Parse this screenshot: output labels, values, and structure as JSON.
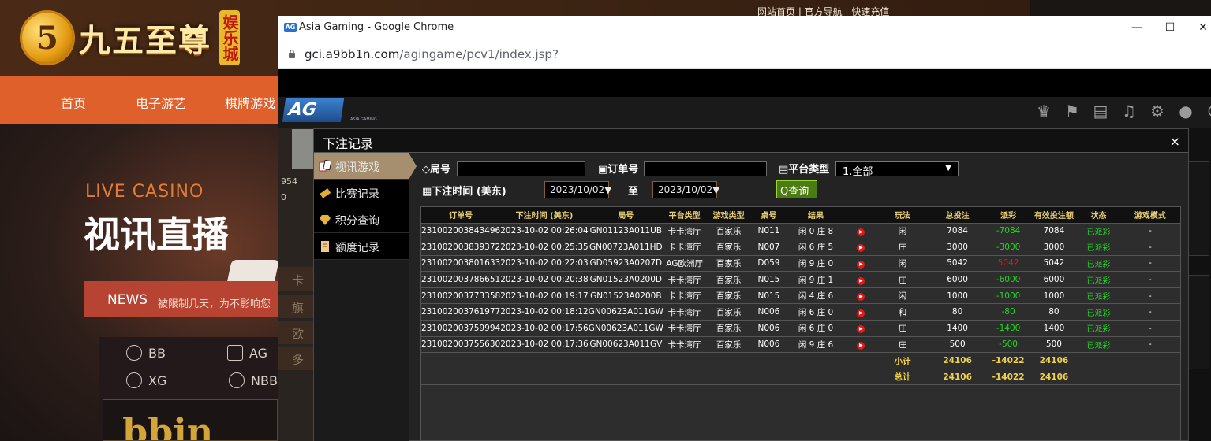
{
  "background_site": {
    "logo_text": "九五至尊",
    "logo_badge": "娱乐城",
    "top_links": "网站首页 | 官方导航 | 快速充值",
    "nav": [
      "首页",
      "电子游艺",
      "棋牌游戏"
    ],
    "live_casino": "LIVE CASINO",
    "live_title": "视讯直播",
    "news_label": "NEWS",
    "news_text": "被限制几天，为不影响您",
    "games": [
      {
        "label": "BB",
        "icon": "bb-icon"
      },
      {
        "label": "AG",
        "icon": "ag-icon"
      },
      {
        "label": "XG",
        "icon": "xg-icon"
      },
      {
        "label": "NBB",
        "icon": "nbb-icon"
      }
    ],
    "bbin": "bbin"
  },
  "browser": {
    "title": "Asia Gaming - Google Chrome",
    "favicon": "AG",
    "url_domain": "gci.a9bb1n.com",
    "url_path": "/agingame/pcv1/index.jsp?"
  },
  "game_page": {
    "ag_logo": "AG",
    "ag_sub": "ASIA GAMING",
    "top_icons": [
      "vip-icon",
      "flag-icon",
      "chat-icon",
      "music-icon",
      "gear-icon",
      "message-icon",
      "power-icon"
    ],
    "side": {
      "balance": "954",
      "points": "0",
      "tab1": "卡",
      "tab2": "旗",
      "tab3": "欧",
      "tab4": "多"
    }
  },
  "modal": {
    "title": "下注记录",
    "close": "×",
    "menu": [
      {
        "label": "视讯游戏",
        "icon": "cards-icon",
        "active": true
      },
      {
        "label": "比赛记录",
        "icon": "ticket-icon",
        "active": false
      },
      {
        "label": "积分查询",
        "icon": "diamond-icon",
        "active": false
      },
      {
        "label": "额度记录",
        "icon": "document-icon",
        "active": false
      }
    ],
    "filters": {
      "round_label": "局号",
      "order_label": "订单号",
      "platform_label": "平台类型",
      "platform_value": "1.全部",
      "time_label": "下注时间 (美东)",
      "date_from": "2023/10/02",
      "to_label": "至",
      "date_to": "2023/10/02",
      "query_label": "查询"
    },
    "table": {
      "headers": [
        "订单号",
        "下注时间 (美东)",
        "局号",
        "平台类型",
        "游戏类型",
        "桌号",
        "结果",
        "",
        "玩法",
        "总投注",
        "派彩",
        "有效投注额",
        "状态",
        "游戏模式"
      ],
      "rows": [
        {
          "order": "231002003843496",
          "time": "2023-10-02 00:26:04",
          "round": "GN01123A011UB",
          "platform": "卡卡湾厅",
          "game": "百家乐",
          "table": "N011",
          "result": "闲 0 庄 8",
          "play": "闲",
          "bet": "7084",
          "payout": "-7084",
          "payout_color": "green",
          "valid": "7084",
          "status": "已派彩",
          "mode": "-"
        },
        {
          "order": "231002003839372",
          "time": "2023-10-02 00:25:35",
          "round": "GN00723A011HD",
          "platform": "卡卡湾厅",
          "game": "百家乐",
          "table": "N007",
          "result": "闲 6 庄 5",
          "play": "庄",
          "bet": "3000",
          "payout": "-3000",
          "payout_color": "green",
          "valid": "3000",
          "status": "已派彩",
          "mode": "-"
        },
        {
          "order": "231002003801633",
          "time": "2023-10-02 00:22:03",
          "round": "GD05923A0207D",
          "platform": "AG欧洲厅",
          "game": "百家乐",
          "table": "D059",
          "result": "闲 9 庄 0",
          "play": "闲",
          "bet": "5042",
          "payout": "5042",
          "payout_color": "red",
          "valid": "5042",
          "status": "已派彩",
          "mode": "-"
        },
        {
          "order": "231002003786651",
          "time": "2023-10-02 00:20:38",
          "round": "GN01523A0200D",
          "platform": "卡卡湾厅",
          "game": "百家乐",
          "table": "N015",
          "result": "闲 9 庄 1",
          "play": "庄",
          "bet": "6000",
          "payout": "-6000",
          "payout_color": "green",
          "valid": "6000",
          "status": "已派彩",
          "mode": "-"
        },
        {
          "order": "231002003773358",
          "time": "2023-10-02 00:19:17",
          "round": "GN01523A0200B",
          "platform": "卡卡湾厅",
          "game": "百家乐",
          "table": "N015",
          "result": "闲 4 庄 6",
          "play": "闲",
          "bet": "1000",
          "payout": "-1000",
          "payout_color": "green",
          "valid": "1000",
          "status": "已派彩",
          "mode": "-"
        },
        {
          "order": "231002003761977",
          "time": "2023-10-02 00:18:12",
          "round": "GN00623A011GW",
          "platform": "卡卡湾厅",
          "game": "百家乐",
          "table": "N006",
          "result": "闲 6 庄 0",
          "play": "和",
          "bet": "80",
          "payout": "-80",
          "payout_color": "green",
          "valid": "80",
          "status": "已派彩",
          "mode": "-"
        },
        {
          "order": "231002003759994",
          "time": "2023-10-02 00:17:56",
          "round": "GN00623A011GW",
          "platform": "卡卡湾厅",
          "game": "百家乐",
          "table": "N006",
          "result": "闲 6 庄 0",
          "play": "庄",
          "bet": "1400",
          "payout": "-1400",
          "payout_color": "green",
          "valid": "1400",
          "status": "已派彩",
          "mode": "-"
        },
        {
          "order": "231002003755630",
          "time": "2023-10-02 00:17:36",
          "round": "GN00623A011GV",
          "platform": "卡卡湾厅",
          "game": "百家乐",
          "table": "N006",
          "result": "闲 9 庄 6",
          "play": "庄",
          "bet": "500",
          "payout": "-500",
          "payout_color": "green",
          "valid": "500",
          "status": "已派彩",
          "mode": "-"
        }
      ],
      "subtotal": {
        "label": "小计",
        "bet": "24106",
        "payout": "-14022",
        "valid": "24106"
      },
      "total": {
        "label": "总计",
        "bet": "24106",
        "payout": "-14022",
        "valid": "24106"
      }
    }
  }
}
